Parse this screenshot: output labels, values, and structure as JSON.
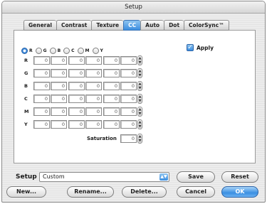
{
  "window": {
    "title": "Setup"
  },
  "tabs": [
    "General",
    "Contrast",
    "Texture",
    "CC",
    "Auto",
    "Dot",
    "ColorSync™"
  ],
  "active_tab": "CC",
  "channel_radios": [
    {
      "label": "R",
      "selected": true
    },
    {
      "label": "G",
      "selected": false
    },
    {
      "label": "B",
      "selected": false
    },
    {
      "label": "C",
      "selected": false
    },
    {
      "label": "M",
      "selected": false
    },
    {
      "label": "Y",
      "selected": false
    }
  ],
  "apply": {
    "label": "Apply",
    "checked": true
  },
  "matrix": {
    "rows": [
      {
        "label": "R",
        "values": [
          "0",
          "0",
          "0",
          "0",
          "0",
          "0"
        ]
      },
      {
        "label": "G",
        "values": [
          "0",
          "0",
          "0",
          "0",
          "0",
          "0"
        ]
      },
      {
        "label": "B",
        "values": [
          "0",
          "0",
          "0",
          "0",
          "0",
          "0"
        ]
      },
      {
        "label": "C",
        "values": [
          "0",
          "0",
          "0",
          "0",
          "0",
          "0"
        ]
      },
      {
        "label": "M",
        "values": [
          "0",
          "0",
          "0",
          "0",
          "0",
          "0"
        ]
      },
      {
        "label": "Y",
        "values": [
          "0",
          "0",
          "0",
          "0",
          "0",
          "0"
        ]
      }
    ]
  },
  "saturation": {
    "label": "Saturation",
    "value": "0"
  },
  "setup": {
    "label": "Setup",
    "selected": "Custom"
  },
  "buttons": {
    "save": "Save",
    "reset": "Reset",
    "new": "New...",
    "rename": "Rename...",
    "delete": "Delete...",
    "cancel": "Cancel",
    "ok": "OK"
  },
  "colors": {
    "accent": "#3b8ee0"
  }
}
